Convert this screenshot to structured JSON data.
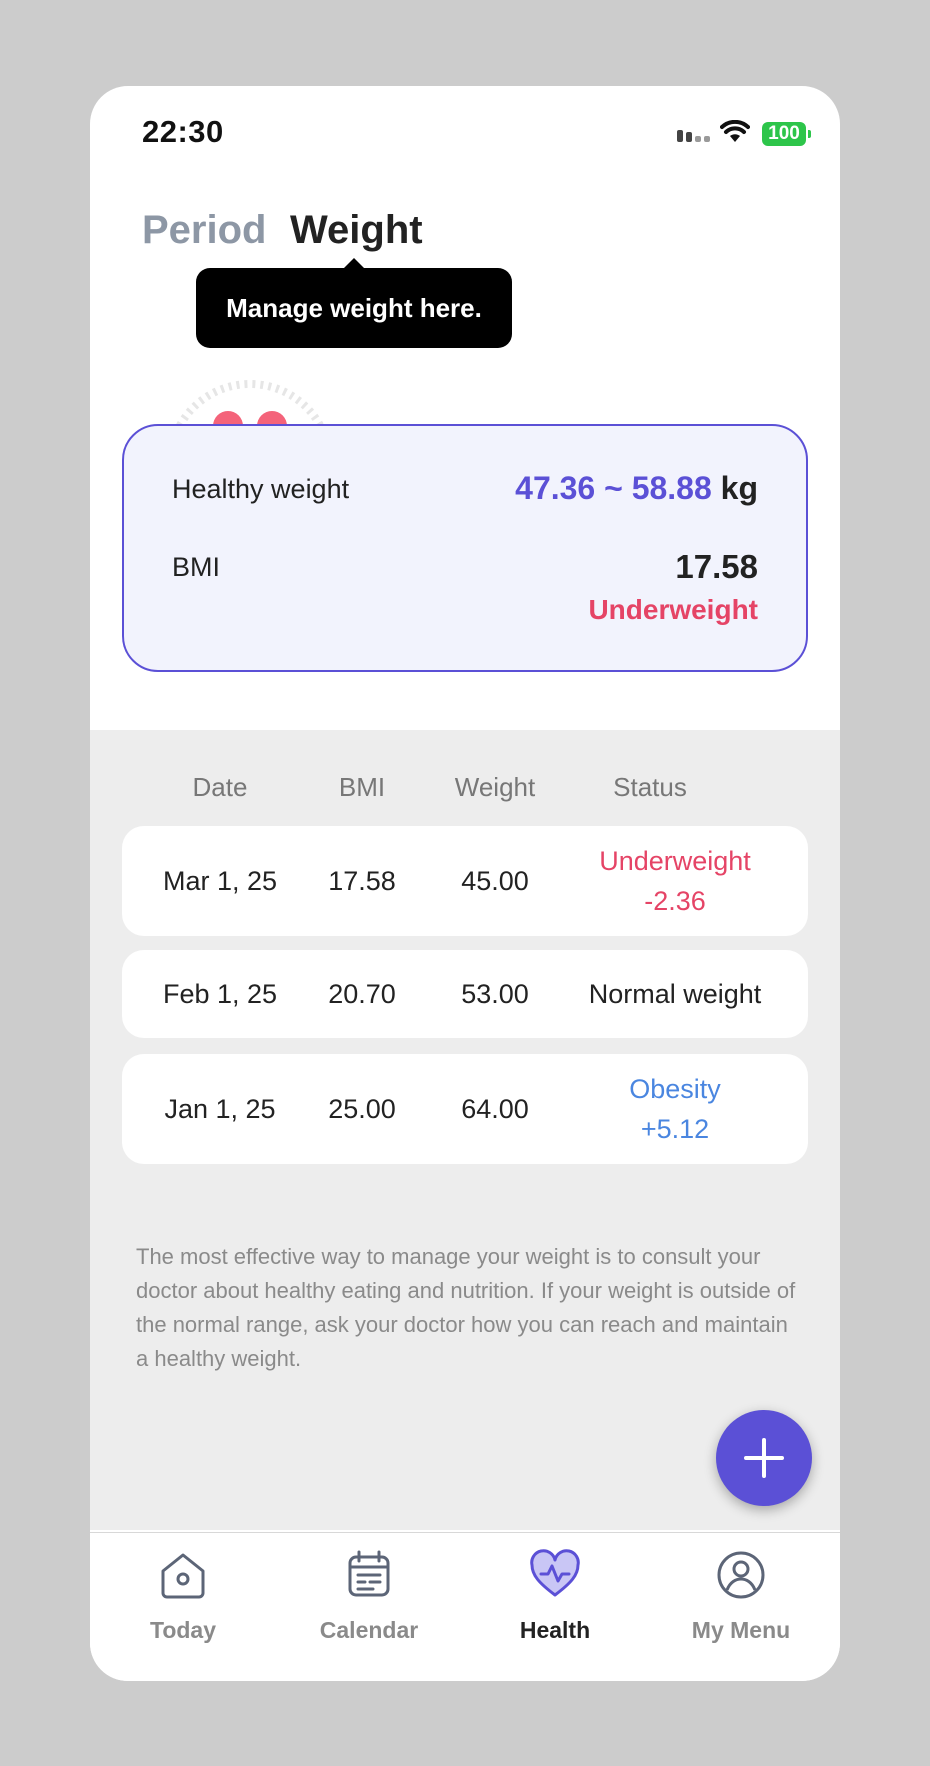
{
  "status_bar": {
    "time": "22:30",
    "battery": "100",
    "battery_color": "#2dc54a"
  },
  "tabs": [
    {
      "label": "Period",
      "active": false
    },
    {
      "label": "Weight",
      "active": true
    }
  ],
  "tooltip": {
    "text": "Manage weight here."
  },
  "summary": {
    "healthy_weight_label": "Healthy weight",
    "healthy_weight_range": "47.36 ~ 58.88",
    "healthy_weight_unit": "kg",
    "bmi_label": "BMI",
    "bmi_value": "17.58",
    "bmi_status": "Underweight"
  },
  "history": {
    "headers": [
      "Date",
      "BMI",
      "Weight",
      "Status"
    ],
    "rows": [
      {
        "date": "Mar 1, 25",
        "bmi": "17.58",
        "weight": "45.00",
        "status": "Underweight",
        "delta": "-2.36",
        "status_type": "under"
      },
      {
        "date": "Feb 1, 25",
        "bmi": "20.70",
        "weight": "53.00",
        "status": "Normal weight",
        "delta": "",
        "status_type": "normal"
      },
      {
        "date": "Jan 1, 25",
        "bmi": "25.00",
        "weight": "64.00",
        "status": "Obesity",
        "delta": "+5.12",
        "status_type": "obese"
      }
    ],
    "note": "The most effective way to manage your weight is to consult your doctor about healthy eating and nutrition. If your weight is outside of the normal range, ask your doctor how you can reach and maintain a healthy weight."
  },
  "fab": {
    "icon": "plus-icon"
  },
  "bottom_nav": [
    {
      "label": "Today",
      "icon": "home-icon",
      "active": false
    },
    {
      "label": "Calendar",
      "icon": "calendar-icon",
      "active": false
    },
    {
      "label": "Health",
      "icon": "heart-pulse-icon",
      "active": true
    },
    {
      "label": "My Menu",
      "icon": "profile-icon",
      "active": false
    }
  ],
  "colors": {
    "accent": "#5b50d6",
    "underweight": "#e54466",
    "obesity": "#4a86e0",
    "mascot": "#f4637a"
  }
}
